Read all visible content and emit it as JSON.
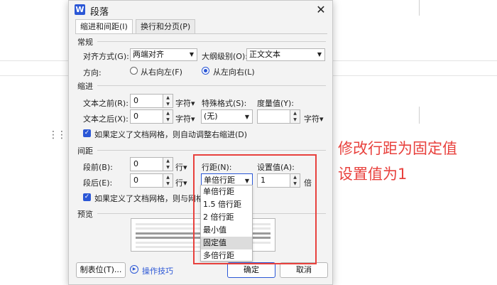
{
  "dialog": {
    "title": "段落",
    "app_icon_letter": "W",
    "close_glyph": "✕",
    "tabs": [
      "缩进和间距(I)",
      "换行和分页(P)"
    ]
  },
  "general": {
    "heading": "常规",
    "alignment_label": "对齐方式(G):",
    "alignment_value": "两端对齐",
    "outline_label": "大纲级别(O):",
    "outline_value": "正文文本",
    "direction_label": "方向:",
    "rtl_label": "从右向左(F)",
    "ltr_label": "从左向右(L)"
  },
  "indent": {
    "heading": "缩进",
    "before_label": "文本之前(R):",
    "before_value": "0",
    "before_unit": "字符▾",
    "after_label": "文本之后(X):",
    "after_value": "0",
    "after_unit": "字符▾",
    "special_label": "特殊格式(S):",
    "special_value": "(无)",
    "measure_label": "度量值(Y):",
    "measure_value": "",
    "measure_unit": "字符▾",
    "grid_check_label": "如果定义了文档网格，则自动调整右缩进(D)"
  },
  "spacing": {
    "heading": "间距",
    "before_label": "段前(B):",
    "before_value": "0",
    "before_unit": "行▾",
    "after_label": "段后(E):",
    "after_value": "0",
    "after_unit": "行▾",
    "line_label": "行距(N):",
    "line_value": "单倍行距",
    "set_label": "设置值(A):",
    "set_value": "1",
    "set_unit": "倍",
    "grid_check_label": "如果定义了文档网格，则与网格"
  },
  "preview": {
    "heading": "预览"
  },
  "buttons": {
    "tabs_button": "制表位(T)...",
    "tips_link": "操作技巧",
    "ok": "确定",
    "cancel": "取消"
  },
  "line_spacing_options": [
    "单倍行距",
    "1.5 倍行距",
    "2 倍行距",
    "最小值",
    "固定值",
    "多倍行距"
  ],
  "line_spacing_highlighted": "固定值",
  "annotation": {
    "line1": "修改行距为固定值",
    "line2": "设置值为1",
    "color": "#e8413d"
  },
  "icons": {
    "app": "wps-writer-icon",
    "close": "close-icon",
    "tips": "play-circle-icon",
    "drag": "drag-handle-icon"
  }
}
